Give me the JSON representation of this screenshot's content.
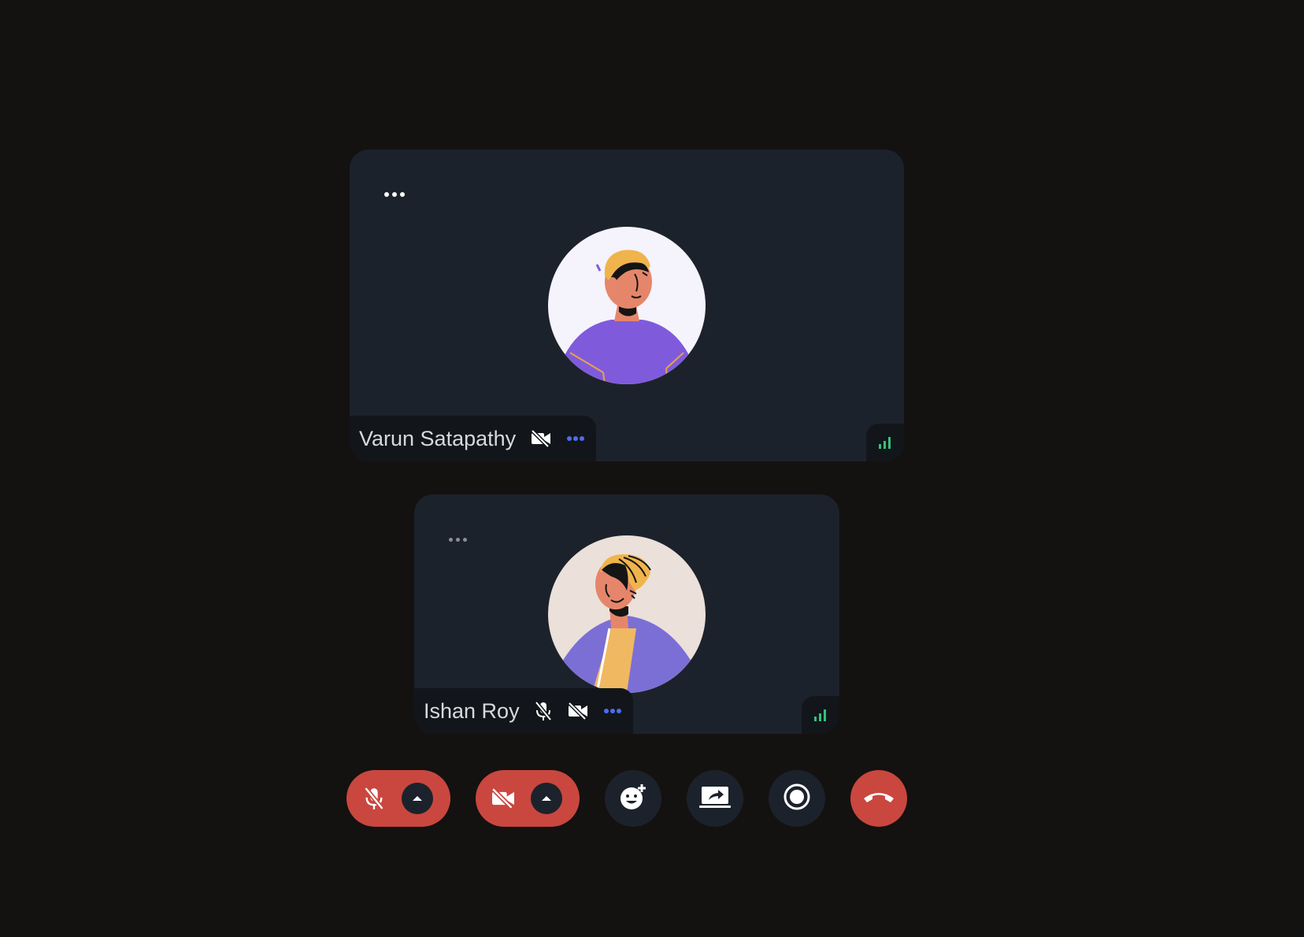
{
  "participants": [
    {
      "name": "Varun Satapathy",
      "mic_muted": false,
      "camera_off": true,
      "signal": "good"
    },
    {
      "name": "Ishan Roy",
      "mic_muted": true,
      "camera_off": true,
      "signal": "good"
    }
  ],
  "toolbar": {
    "buttons": [
      {
        "id": "mic",
        "state": "muted",
        "icon": "mic-off-icon"
      },
      {
        "id": "camera",
        "state": "off",
        "icon": "video-off-icon"
      },
      {
        "id": "emoji",
        "icon": "emoji-add-icon"
      },
      {
        "id": "share",
        "icon": "screen-share-icon"
      },
      {
        "id": "record",
        "icon": "record-icon"
      },
      {
        "id": "leave",
        "icon": "end-call-icon"
      }
    ]
  },
  "colors": {
    "background": "#141111",
    "tile": "#1c222b",
    "danger": "#c9473f",
    "accent": "#4e6cf0",
    "signal": "#34c17a"
  }
}
